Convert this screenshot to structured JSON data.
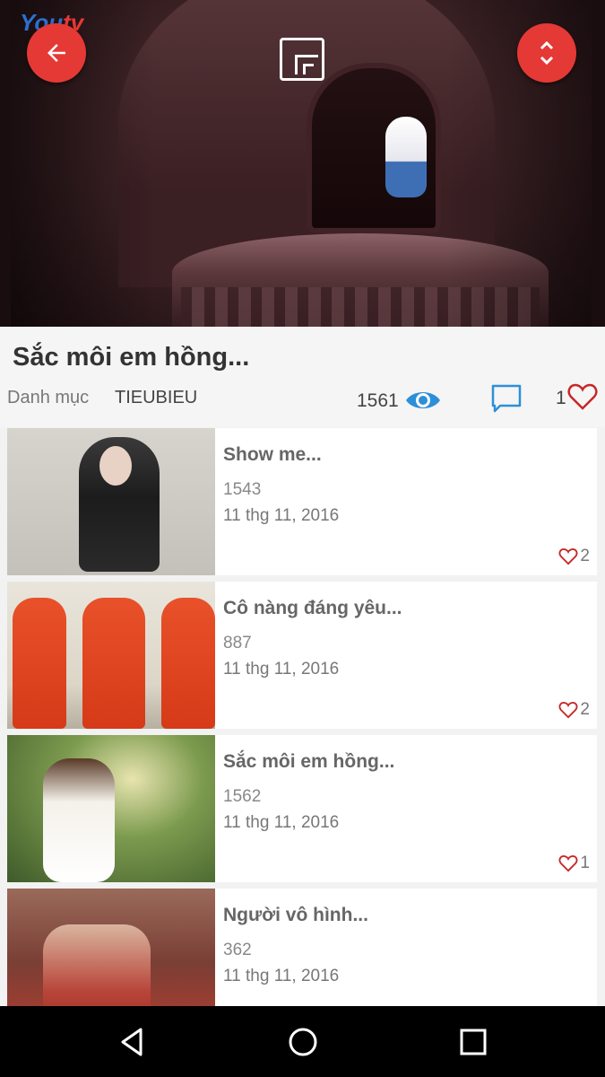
{
  "app": {
    "logo_text": "You",
    "logo_accent": "tv"
  },
  "player": {
    "back_icon": "arrow-left-icon",
    "pip_icon": "picture-in-picture-icon",
    "expand_icon": "expand-collapse-icon"
  },
  "video": {
    "title": "Sắc môi em hồng...",
    "category_label": "Danh mục",
    "category_value": "TIEUBIEU",
    "views": "1561",
    "likes": "1"
  },
  "list": [
    {
      "title": "Show me...",
      "views": "1543",
      "date": "11 thg 11, 2016",
      "likes": "2"
    },
    {
      "title": "Cô nàng đáng yêu...",
      "views": "887",
      "date": "11 thg 11, 2016",
      "likes": "2"
    },
    {
      "title": "Sắc môi em hồng...",
      "views": "1562",
      "date": "11 thg 11, 2016",
      "likes": "1"
    },
    {
      "title": "Người vô hình...",
      "views": "362",
      "date": "11 thg 11, 2016",
      "likes": ""
    }
  ],
  "colors": {
    "accent": "#e53935",
    "eye": "#2d8fd8",
    "comment": "#2d8fd8",
    "heart": "#c62828"
  }
}
